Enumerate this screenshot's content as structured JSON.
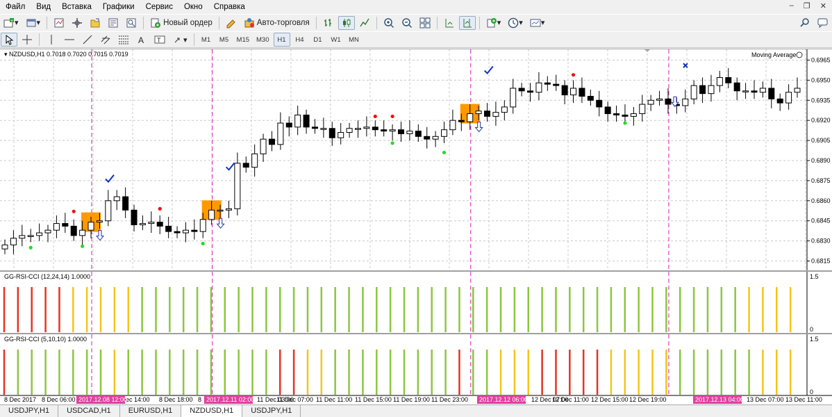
{
  "menu": [
    "Файл",
    "Вид",
    "Вставка",
    "Графики",
    "Сервис",
    "Окно",
    "Справка"
  ],
  "toolbar": {
    "new_order_label": "Новый ордер",
    "auto_trading_label": "Авто-торговля",
    "timeframes": [
      "M1",
      "M5",
      "M15",
      "M30",
      "H1",
      "H4",
      "D1",
      "W1",
      "MN"
    ],
    "active_timeframe": "H1"
  },
  "chart": {
    "header": "NZDUSD,H1  0.7018 0.7020 0.7015 0.7019",
    "ma_label": "Moving Average",
    "colors": {
      "bull": "#ffffff",
      "bear": "#000000",
      "grid": "#c8c8c8",
      "vline": "#e040c0",
      "box": "#ff9900",
      "green_bar": "#8cc63f",
      "yellow_bar": "#f5c518",
      "red_bar": "#e8321e"
    }
  },
  "chart_data": {
    "type": "candlestick",
    "symbol": "NZDUSD",
    "timeframe": "H1",
    "price_ticks": [
      "0.6965",
      "0.6950",
      "0.6935",
      "0.6920",
      "0.6905",
      "0.6890",
      "0.6875",
      "0.6860",
      "0.6845",
      "0.6830",
      "0.6815"
    ],
    "time_labels": [
      "8 Dec 2017",
      "8 Dec 06:00",
      "8 Dec 14:00",
      "8 Dec 18:00",
      "8",
      "11 Dec 03:00",
      "11 Dec 07:00",
      "11 Dec 11:00",
      "11 Dec 15:00",
      "11 Dec 19:00",
      "11 Dec 23:00",
      "12 Dec 07:00",
      "12 Dec 11:00",
      "12 Dec 15:00",
      "12 Dec 19:00",
      "13 Dec 07:00",
      "13 Dec 11:00"
    ],
    "highlighted_times": [
      "2017.12.08 12:00",
      "2017.12.11 02:00",
      "2017.12.12 06:00",
      "2017.12.13 04:00"
    ],
    "indicator1": {
      "label": "GG-RSI-CCI (12,24,14) 1.0000",
      "max": "1.5",
      "min": "0",
      "colors": "RRRRRYYYYYGGGGGGGGGGGGGGGGGGGGGGGGGGGGGGGGGGGGGGGGGGGGYYYYYGGGGGGGGGGGGGGGGGGGGGGGGYYYYRRRRRRYYRRRRR"
    },
    "indicator2": {
      "label": "GG-RSI-CCI (5,10,10) 1.0000",
      "max": "1.5",
      "min": "0",
      "colors": "RGGGGGGGYGGGGGGGGGGGRRYYGGGGGGGGGRGGYYYRRRRRYYYYYGGGGGGYYYYYRRRRRRRRRYYRRRGGGYYGGGRRRRRYYYRRRYYRYYYRR"
    }
  },
  "tabs": [
    "USDJPY,H1",
    "USDCAD,H1",
    "EURUSD,H1",
    "NZDUSD,H1",
    "USDJPY,H1"
  ],
  "active_tab": "NZDUSD,H1"
}
